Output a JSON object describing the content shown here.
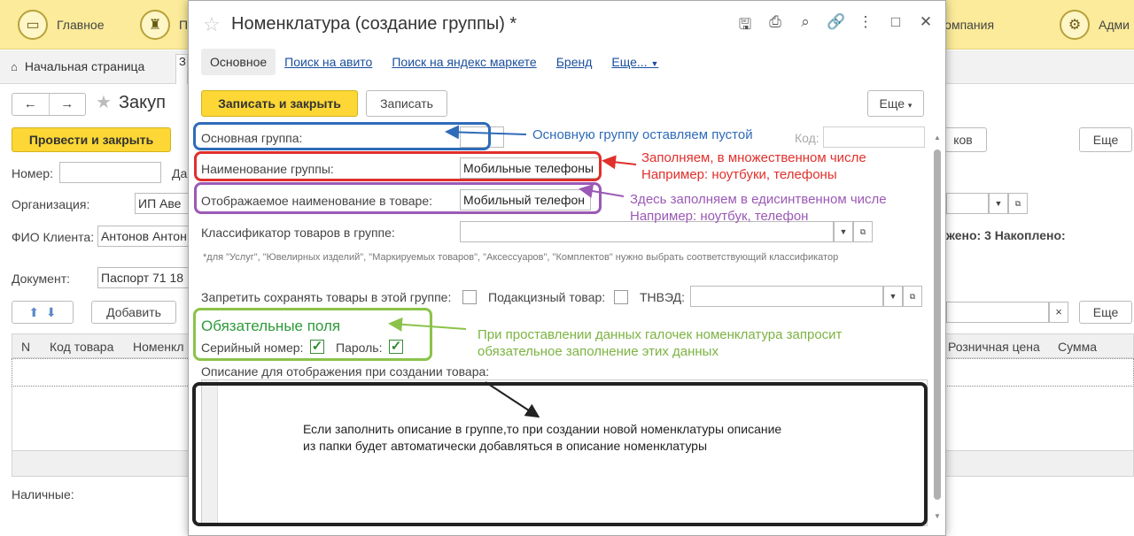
{
  "topbar": {
    "sections": [
      {
        "label": "Главное",
        "icon": "home-section-icon"
      },
      {
        "label": "П",
        "icon": "cart-section-icon"
      },
      {
        "label": "Компания",
        "icon": "company-section-icon"
      },
      {
        "label": "Адми",
        "icon": "admin-section-icon"
      }
    ]
  },
  "tabs": {
    "home": "Начальная страница",
    "active": "З"
  },
  "background_doc": {
    "title": "Закуп",
    "post_close": "Провести и закрыть",
    "more": "Еще",
    "number_label": "Номер:",
    "date_label_prefix": "Да",
    "org_label": "Организация:",
    "org_value": "ИП Аве",
    "client_label": "ФИО Клиента:",
    "client_value": "Антонов Антон",
    "doc_label": "Документ:",
    "doc_value": "Паспорт 71 18",
    "add_label": "Добавить",
    "more2": "Еще",
    "right_btn": "ков",
    "totals": "жено: 3 Накоплено:",
    "cash_label": "Наличные:",
    "columns": [
      "N",
      "Код товара",
      "Номенкл",
      "Розничная цена",
      "Сумма"
    ]
  },
  "modal": {
    "title": "Номенклатура (создание группы) *",
    "tabs": [
      "Основное",
      "Поиск на авито",
      "Поиск на яндекс маркете",
      "Бренд",
      "Еще..."
    ],
    "save_close": "Записать и закрыть",
    "save": "Записать",
    "more": "Еще",
    "fields": {
      "parent_group": {
        "label": "Основная группа:",
        "value": ""
      },
      "code": {
        "label": "Код:",
        "value": ""
      },
      "group_name": {
        "label": "Наименование группы:",
        "value": "Мобильные телефоны"
      },
      "display_name": {
        "label": "Отображаемое наименование в товаре:",
        "value": "Мобильный телефон"
      },
      "classifier": {
        "label": "Классификатор товаров в группе:",
        "value": ""
      }
    },
    "note": "*для \"Услуг\", \"Ювелирных изделий\", \"Маркируемых товаров\", \"Аксессуаров\", \"Комплектов\" нужно выбрать соответствующий классификатор",
    "forbid_label": "Запретить сохранять товары в этой группе:",
    "forbid_checked": false,
    "excise_label": "Подакцизный товар:",
    "excise_checked": false,
    "tnved_label": "ТНВЭД:",
    "tnved_value": "",
    "required_title": "Обязательные поля",
    "serial_label": "Серийный номер:",
    "serial_checked": true,
    "password_label": "Пароль:",
    "password_checked": true,
    "description_label": "Описание для отображения при создании товара:"
  },
  "annotations": {
    "blue": "Основную группу оставляем пустой",
    "red_1": "Заполняем, в множественном числе",
    "red_2": "Например: ноутбуки, телефоны",
    "purple_1": "Здесь заполняем в едисинтвенном числе",
    "purple_2": "Например: ноутбук, телефон",
    "green_1": "При проставлении данных галочек номенклатура запросит",
    "green_2": "обязательное заполнение этих данных",
    "black_1": "Если заполнить описание в группе,то при создании новой номенклатуры описание",
    "black_2": "из папки будет автоматически добавляться в описание номенклатуры"
  },
  "colors": {
    "blue": "#2f6bb8",
    "red": "#e0302c",
    "purple": "#9b59b6",
    "green": "#8bc34a",
    "black": "#222222",
    "accent_yellow": "#fcd735"
  }
}
